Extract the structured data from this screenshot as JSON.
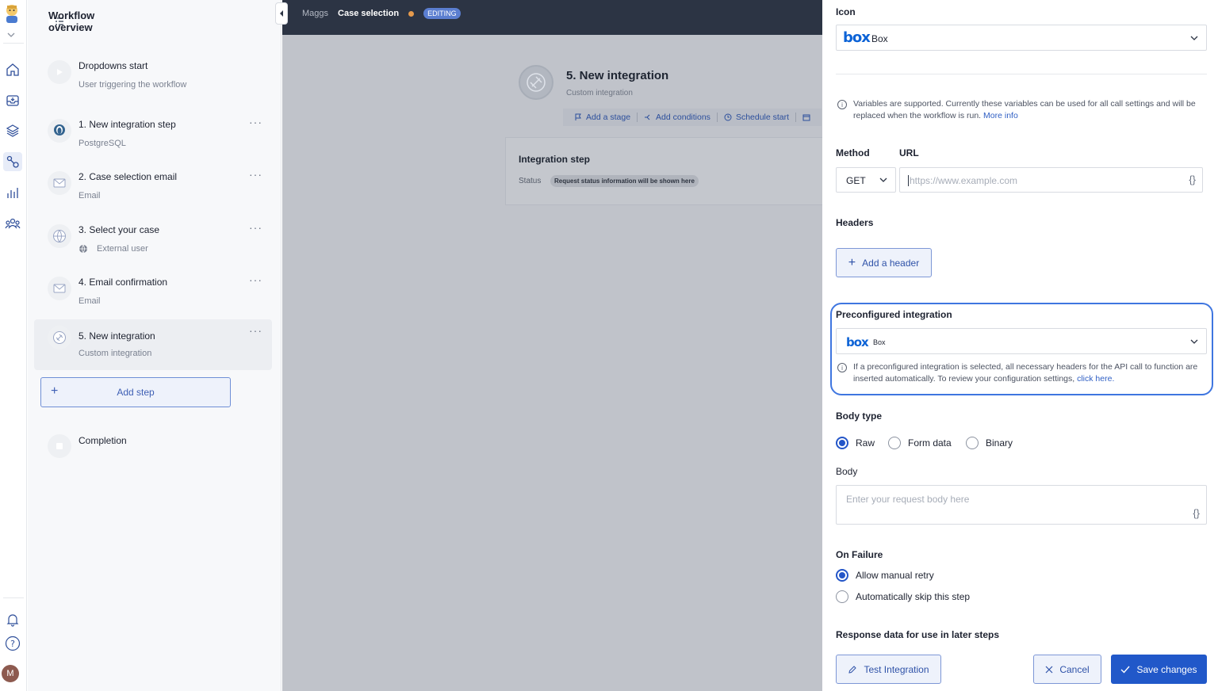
{
  "sidebar_rail": {
    "icons": [
      "avatar-icon",
      "chevron-down-icon",
      "home-icon",
      "inbox-icon",
      "layers-icon",
      "workflow-icon",
      "chart-icon",
      "users-icon",
      "bell-icon",
      "help-icon"
    ],
    "user_initial": "M"
  },
  "workflow": {
    "header": "Workflow overview",
    "start": {
      "title": "Dropdowns start",
      "sub": "User triggering the workflow"
    },
    "steps": [
      {
        "title": "1. New integration step",
        "sub": "PostgreSQL"
      },
      {
        "title": "2. Case selection email",
        "sub": "Email"
      },
      {
        "title": "3. Select your case",
        "sub": "External user"
      },
      {
        "title": "4. Email confirmation",
        "sub": "Email"
      },
      {
        "title": "5. New integration",
        "sub": "Custom integration"
      }
    ],
    "add_step": "Add step",
    "completion": "Completion",
    "more": "···"
  },
  "topbar": {
    "crumb1": "Maggs",
    "crumb2": "Case selection",
    "badge": "EDITING"
  },
  "canvas": {
    "node_title": "5. New integration",
    "node_sub": "Custom integration",
    "actions": [
      "Add a stage",
      "Add conditions",
      "Schedule start"
    ],
    "card_title": "Integration step",
    "status_label": "Status",
    "status_value": "Request status information will be shown here"
  },
  "panel": {
    "icon_label": "Icon",
    "icon_logo": "box",
    "icon_value": "Box",
    "vars_note": "Variables are supported. Currently these variables can be used for all call settings and will be replaced when the workflow is run.",
    "more_info": "More info",
    "method_label": "Method",
    "method_value": "GET",
    "url_label": "URL",
    "url_placeholder": "https://www.example.com",
    "braces": "{}",
    "headers_label": "Headers",
    "add_header": "Add a header",
    "preconf_label": "Preconfigured integration",
    "preconf_logo": "box",
    "preconf_value": "Box",
    "preconf_note": "If a preconfigured integration is selected, all necessary headers for the API call to function are inserted automatically. To review your configuration settings,",
    "click_here": "click here.",
    "body_type_label": "Body type",
    "body_types": [
      "Raw",
      "Form data",
      "Binary"
    ],
    "body_label": "Body",
    "body_placeholder": "Enter your request body here",
    "on_failure_label": "On Failure",
    "failure_options": [
      "Allow manual retry",
      "Automatically skip this step"
    ],
    "response_label": "Response data for use in later steps",
    "test_btn": "Test Integration",
    "cancel_btn": "Cancel",
    "save_btn": "Save changes"
  },
  "colors": {
    "accent": "#2158c9",
    "topbar": "#2c3444",
    "canvas": "#c0c3ca",
    "box_brand": "#0d63d6"
  }
}
